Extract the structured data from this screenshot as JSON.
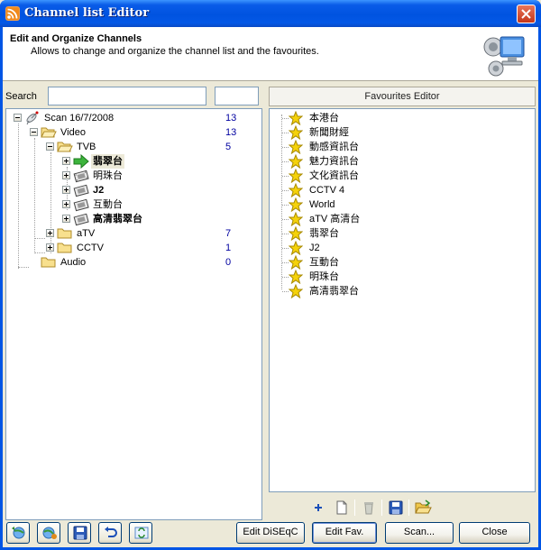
{
  "window": {
    "title": "Channel list Editor"
  },
  "header": {
    "title": "Edit and Organize Channels",
    "subtitle": "Allows to change and organize the channel list and the favourites."
  },
  "search": {
    "label": "Search",
    "value": "",
    "value2": ""
  },
  "tree": [
    {
      "label": "Scan 16/7/2008",
      "count": "13",
      "icon": "satellite-icon",
      "bold": false
    },
    {
      "label": "Video",
      "count": "13",
      "icon": "folder-icon",
      "bold": false
    },
    {
      "label": "TVB",
      "count": "5",
      "icon": "folder-icon",
      "bold": false
    },
    {
      "label": "翡翠台",
      "count": "",
      "icon": "play-arrow-icon",
      "bold": true
    },
    {
      "label": "明珠台",
      "count": "",
      "icon": "film-icon",
      "bold": false
    },
    {
      "label": "J2",
      "count": "",
      "icon": "film-icon",
      "bold": true
    },
    {
      "label": "互動台",
      "count": "",
      "icon": "film-icon",
      "bold": false
    },
    {
      "label": "高清翡翠台",
      "count": "",
      "icon": "film-icon",
      "bold": true
    },
    {
      "label": "aTV",
      "count": "7",
      "icon": "folder-icon",
      "bold": false
    },
    {
      "label": "CCTV",
      "count": "1",
      "icon": "folder-icon",
      "bold": false
    },
    {
      "label": "Audio",
      "count": "0",
      "icon": "folder-icon",
      "bold": false
    }
  ],
  "favourites": {
    "title": "Favourites Editor",
    "items": [
      "本港台",
      "新聞財經",
      "動感資訊台",
      "魅力資訊台",
      "文化資訊台",
      "CCTV 4",
      "World",
      "aTV 高清台",
      "翡翠台",
      "J2",
      "互動台",
      "明珠台",
      "高清翡翠台"
    ]
  },
  "buttons": {
    "edit_diseqc": "Edit DiSEqC",
    "edit_fav": "Edit Fav.",
    "scan": "Scan...",
    "close": "Close"
  },
  "colors": {
    "titlebar": "#0054e3",
    "count": "#0000a0",
    "star": "#f5d20a"
  }
}
